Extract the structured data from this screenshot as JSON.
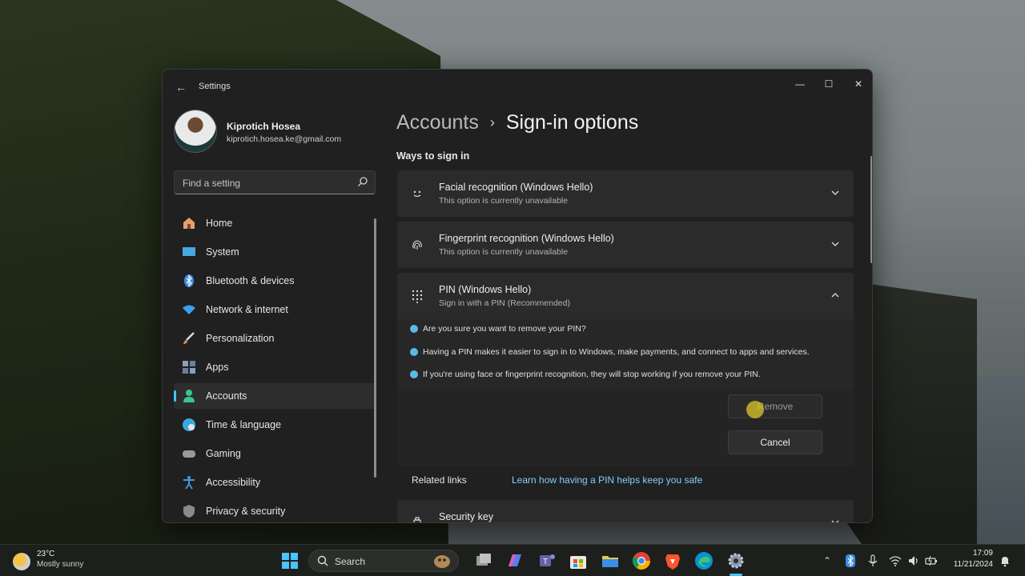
{
  "window": {
    "app_title": "Settings",
    "controls": {
      "minimize": "—",
      "maximize": "☐",
      "close": "✕"
    }
  },
  "profile": {
    "name": "Kiprotich Hosea",
    "email": "kiprotich.hosea.ke@gmail.com"
  },
  "search": {
    "placeholder": "Find a setting"
  },
  "sidebar": {
    "items": [
      {
        "label": "Home",
        "icon": "home-icon",
        "color": "#e8a06a"
      },
      {
        "label": "System",
        "icon": "display-icon",
        "color": "#4aa8e0"
      },
      {
        "label": "Bluetooth & devices",
        "icon": "bluetooth-icon",
        "color": "#3a8ee6"
      },
      {
        "label": "Network & internet",
        "icon": "wifi-icon",
        "color": "#3aa0f0"
      },
      {
        "label": "Personalization",
        "icon": "brush-icon",
        "color": "#e08a4a"
      },
      {
        "label": "Apps",
        "icon": "apps-icon",
        "color": "#8aa0b8"
      },
      {
        "label": "Accounts",
        "icon": "person-icon",
        "color": "#3cc48c"
      },
      {
        "label": "Time & language",
        "icon": "globe-clock-icon",
        "color": "#3aa8e0"
      },
      {
        "label": "Gaming",
        "icon": "gamepad-icon",
        "color": "#9a9a9a"
      },
      {
        "label": "Accessibility",
        "icon": "accessibility-icon",
        "color": "#3a9ae6"
      },
      {
        "label": "Privacy & security",
        "icon": "shield-icon",
        "color": "#8a8a8a"
      }
    ],
    "active_index": 6
  },
  "breadcrumb": {
    "parent": "Accounts",
    "separator": "›",
    "current": "Sign-in options"
  },
  "main": {
    "section_title": "Ways to sign in",
    "options": [
      {
        "title": "Facial recognition (Windows Hello)",
        "subtitle": "This option is currently unavailable",
        "icon": "face-icon",
        "expanded": false
      },
      {
        "title": "Fingerprint recognition (Windows Hello)",
        "subtitle": "This option is currently unavailable",
        "icon": "fingerprint-icon",
        "expanded": false
      },
      {
        "title": "PIN (Windows Hello)",
        "subtitle": "Sign in with a PIN (Recommended)",
        "icon": "keypad-icon",
        "expanded": true
      }
    ],
    "pin_messages": [
      "Are you sure you want to remove your PIN?",
      "Having a PIN makes it easier to sign in to Windows, make payments, and connect to apps and services.",
      "If you're using face or fingerprint recognition, they will stop working if you remove your PIN."
    ],
    "remove_label": "Remove",
    "cancel_label": "Cancel",
    "related_label": "Related links",
    "related_link": "Learn how having a PIN helps keep you safe",
    "next_option": {
      "title": "Security key",
      "icon": "key-icon"
    }
  },
  "taskbar": {
    "weather_temp": "23°C",
    "weather_desc": "Mostly sunny",
    "search_label": "Search",
    "time": "17:09",
    "date": "11/21/2024"
  },
  "colors": {
    "accent": "#4cc2ff",
    "link": "#7fd0ff",
    "window_bg": "#202020",
    "card_bg": "#2b2b2b"
  }
}
